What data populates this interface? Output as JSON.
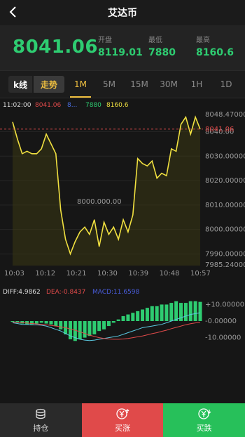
{
  "header": {
    "title": "艾达币"
  },
  "price": {
    "last": "8041.06",
    "open_label": "开盘",
    "open": "8119.01",
    "low_label": "最低",
    "low": "7880",
    "high_label": "最高",
    "high": "8160.6"
  },
  "tabs": [
    "k线",
    "走势",
    "1M",
    "5M",
    "15M",
    "30M",
    "1H",
    "1D"
  ],
  "chart_data": {
    "type": "line",
    "info": {
      "time": "11:02:00",
      "v1": "8041.06",
      "v2": "8...",
      "v3": "7880",
      "v4": "8160.6"
    },
    "price_axis": [
      "8048.47000",
      "8040.00",
      "8030.00000",
      "8020.00000",
      "8010.00000",
      "8000.00000",
      "7990.00000",
      "7985.24000"
    ],
    "price_tag": "8041.06",
    "overlay_text": "8000.000.00",
    "x_labels": [
      "10:03",
      "10:12",
      "10:21",
      "10:30",
      "10:39",
      "10:48",
      "10:57"
    ],
    "ylim": [
      7985.24,
      8048.47
    ],
    "values": [
      8044,
      8037,
      8031,
      8032,
      8031,
      8031,
      8033,
      8039,
      8035,
      8031,
      8008,
      7996,
      7990,
      7995,
      7999,
      8001,
      7998,
      8004,
      7993,
      8003,
      7998,
      8001,
      7996,
      8004,
      7999,
      8006,
      8029,
      8027,
      8026,
      8028,
      8021,
      8023,
      8022,
      8033,
      8032,
      8043,
      8046,
      8039,
      8046,
      8041.06
    ],
    "macd": {
      "diff_label": "DIFF:4.9862",
      "dea_label": "DEA:-0.8437",
      "macd_label": "MACD:11.6598",
      "axis": [
        "+10.00000",
        "-0.00000",
        "-10.00000"
      ],
      "ylim": [
        -14,
        14
      ],
      "bars": [
        -0.5,
        -1,
        -1.5,
        -2,
        -2,
        -1.5,
        -1,
        -1.5,
        -2,
        -3,
        -5,
        -8,
        -11,
        -12,
        -11,
        -10,
        -9,
        -8,
        -6,
        -5,
        -3,
        -1,
        1,
        3,
        4,
        5,
        6,
        7,
        8,
        9,
        9,
        10,
        10,
        11,
        12,
        11,
        11,
        12,
        12,
        11.6
      ],
      "diff": [
        -1,
        -1.5,
        -2,
        -2,
        -2.2,
        -2.3,
        -2.5,
        -3,
        -4,
        -5,
        -6,
        -7.5,
        -9,
        -10,
        -11,
        -11.5,
        -11.8,
        -11.5,
        -11,
        -10.5,
        -10,
        -9.5,
        -9,
        -8,
        -7,
        -6,
        -5,
        -4,
        -3.5,
        -3,
        -2.5,
        -2,
        -1,
        0,
        1,
        2,
        3,
        4,
        4.5,
        4.99
      ],
      "dea": [
        -0.5,
        -0.8,
        -1,
        -1.2,
        -1.5,
        -1.7,
        -2,
        -2.3,
        -2.6,
        -3,
        -3.5,
        -4,
        -4.8,
        -5.5,
        -6.5,
        -7.5,
        -8.5,
        -9.3,
        -10,
        -10.5,
        -10.8,
        -11,
        -11,
        -10.8,
        -10.5,
        -10,
        -9.5,
        -9,
        -8.3,
        -7.6,
        -7,
        -6.2,
        -5.5,
        -4.6,
        -3.8,
        -3,
        -2.2,
        -1.6,
        -1.1,
        -0.84
      ]
    }
  },
  "bottom": {
    "hold": "持仓",
    "buy_up": "买涨",
    "buy_down": "买跌"
  }
}
